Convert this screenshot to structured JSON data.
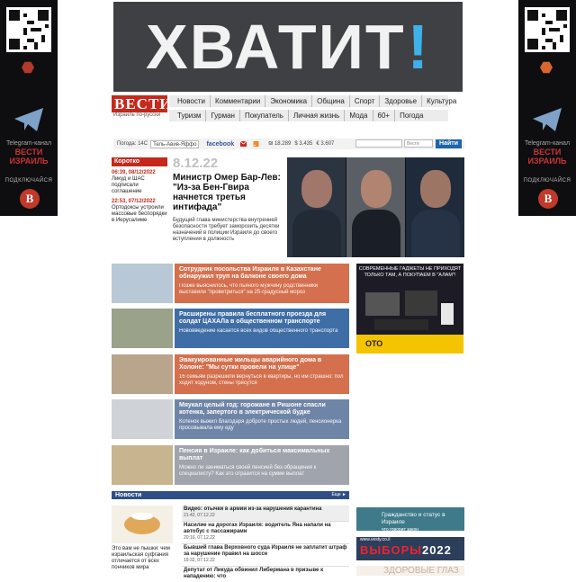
{
  "side_ad": {
    "channel_line": "Telegram-канал",
    "brand_line1": "ВЕСТИ",
    "brand_line2": "ИЗРАИЛЬ",
    "subscribe": "ПОДКЛЮЧАЙСЯ",
    "badge": "В"
  },
  "banner": {
    "text": "ХВАТИТ",
    "mark": "!"
  },
  "logo": {
    "name": "ВЕСТИ",
    "tagline": "Израиль по-русски"
  },
  "nav": {
    "row1": [
      "Новости",
      "Комментарии",
      "Экономика",
      "Община",
      "Спорт",
      "Здоровье",
      "Культура"
    ],
    "row2": [
      "Туризм",
      "Гурман",
      "Покупатель",
      "Личная жизнь",
      "Мода",
      "60+",
      "Погода"
    ]
  },
  "toolbar": {
    "weather_label": "Погода: 14С",
    "city": "Тель-Авив-Яффо",
    "facebook": "facebook",
    "rates": [
      "₪ 18.289",
      "$ 3.435",
      "€ 3.607"
    ],
    "search_scope": "Вести",
    "search_button": "Найти"
  },
  "short_news": {
    "header": "Коротко",
    "items": [
      {
        "time": "06:39, 08/12/2022",
        "text": "Ликуд и ШАС подписали соглашение"
      },
      {
        "time": "22:53, 07/12/2022",
        "text": "Ортодоксы устроили массовые беспорядки в Иерусалиме"
      }
    ]
  },
  "lead": {
    "date": "8.12.22",
    "title": "Министр Омер Бар-Лев: \"Из-за Бен-Гвира начнется третья интифада\"",
    "text": "Будущий глава министерства внутренней безопасности требует заморозить десятки назначений в полиции Израиля до своего вступления в должность"
  },
  "stories": [
    {
      "title": "Сотрудник посольства Израиля в Казахстане обнаружил труп на балконе своего дома",
      "summary": "Позже выяснилось, что пьяного мужчину родственники выставили \"проветриться\" на 25-градусный мороз",
      "color": "#d4704d",
      "thumb": "#b9c8d6"
    },
    {
      "title": "Расширены правила бесплатного проезда для солдат ЦАХАЛа в общественном транспорте",
      "summary": "Нововведение касается всех видов общественного транспорта",
      "color": "#3f6ea6",
      "thumb": "#9aa38a"
    },
    {
      "title": "Эвакуированные жильцы аварийного дома в Холоне: \"Мы сутки провели на улице\"",
      "summary": "16 семьям разрешили вернуться в квартиры, но им страшно: пол ходит ходуном, стены трясутся",
      "color": "#d4704d",
      "thumb": "#b8a58c"
    },
    {
      "title": "Мяукал целый год: горожане в Ришоне спасли котенка, запертого в электрической будке",
      "summary": "Котенок выжил благодаря доброте простых людей, пенсионерка просовывала ему еду",
      "color": "#6f85a8",
      "thumb": "#cfd3d8"
    },
    {
      "title": "Пенсия в Израиле: как добиться максимальных выплат",
      "summary": "Можно ли заниматься своей пенсией без обращения к специалисту? Как это отразится на сумме выплат",
      "color": "#a0a4ac",
      "thumb": "#c8b48e"
    }
  ],
  "promo": {
    "text": "СОВРЕМЕННЫЕ ГАДЖЕТЫ НЕ ПРИХОДЯТ ТОЛЬКО ТАМ, А ПОКУПАЕМ В \"АЛАМ\"!",
    "brand": "ОТО"
  },
  "news_bar": {
    "title": "Новости",
    "more": "Еще ►"
  },
  "news_feature": {
    "caption": "Это вам не пышки: чем израильская суфгания отличается от всех пончиков мира"
  },
  "news_list": [
    {
      "title": "Видео: отычки в армии из-за нарушения карантина",
      "time": "21:42, 07.12.22"
    },
    {
      "title": "Насилие на дорогах Израиля: водитель Яна напали на автобус с пассажирами",
      "time": "20:16, 07.12.22"
    },
    {
      "title": "Бывший глава Верховного суда Израиля не заплатит штраф за нарушение правил на шоссе",
      "time": "19:32, 07.12.22"
    },
    {
      "title": "Депутат от Ликуда обвинил Либермана в призыве к нападению: что"
    }
  ],
  "right_blocks": {
    "citizenship": "Гражданство и статус в Израиле",
    "citizenship_sub": "что говорит закон",
    "elections_url": "www.vesty.co.il",
    "elections": "ВЫБОРЫ",
    "year": "2022",
    "health": "ЗДОРОВЫЕ ГЛАЗ"
  }
}
